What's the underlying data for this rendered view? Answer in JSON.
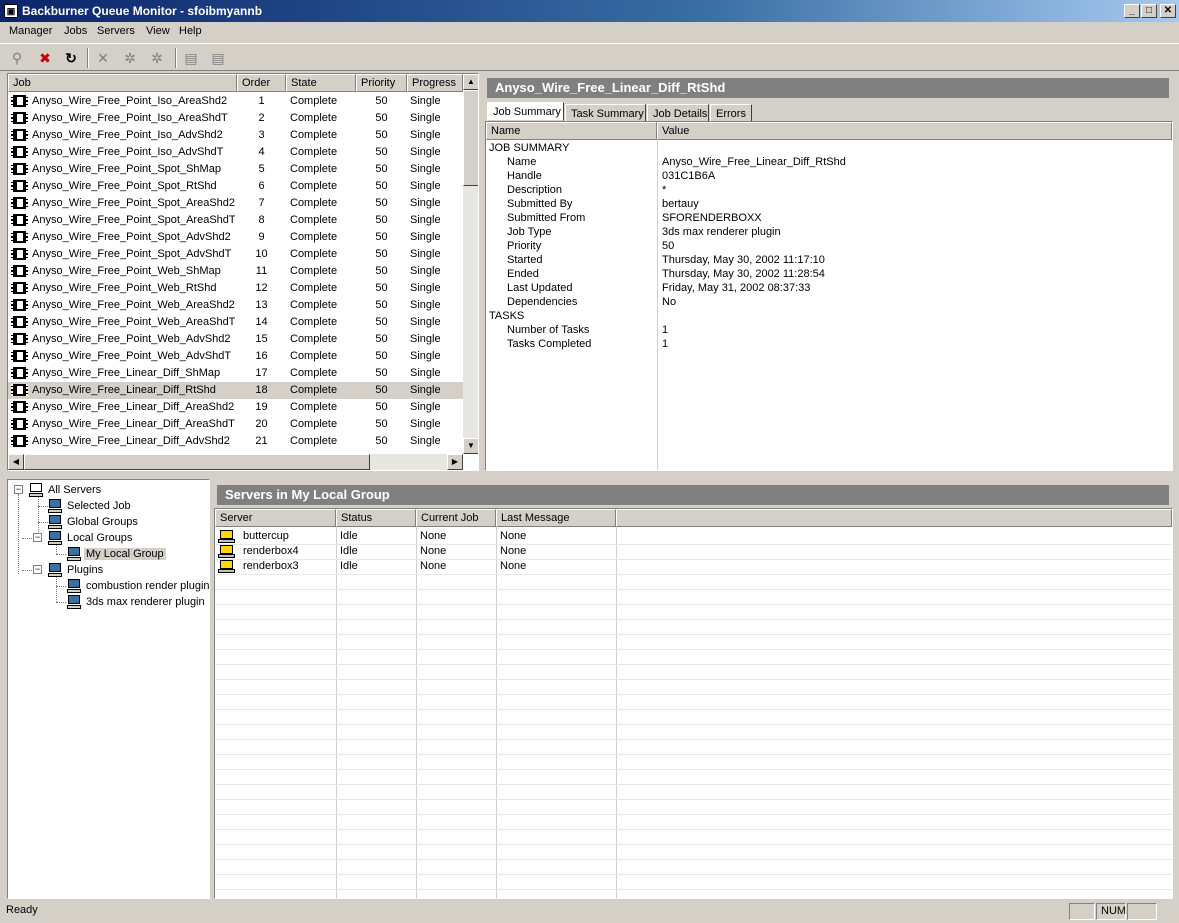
{
  "window": {
    "title": "Backburner Queue Monitor - sfoibmyannb",
    "min": "_",
    "max": "□",
    "close": "✕"
  },
  "menu": [
    "Manager",
    "Jobs",
    "Servers",
    "View",
    "Help"
  ],
  "jobs": {
    "columns": [
      "Job",
      "Order",
      "State",
      "Priority",
      "Progress"
    ],
    "rows": [
      [
        "Anyso_Wire_Free_Point_Iso_AreaShd2",
        "1",
        "Complete",
        "50",
        "Single"
      ],
      [
        "Anyso_Wire_Free_Point_Iso_AreaShdT",
        "2",
        "Complete",
        "50",
        "Single"
      ],
      [
        "Anyso_Wire_Free_Point_Iso_AdvShd2",
        "3",
        "Complete",
        "50",
        "Single"
      ],
      [
        "Anyso_Wire_Free_Point_Iso_AdvShdT",
        "4",
        "Complete",
        "50",
        "Single"
      ],
      [
        "Anyso_Wire_Free_Point_Spot_ShMap",
        "5",
        "Complete",
        "50",
        "Single"
      ],
      [
        "Anyso_Wire_Free_Point_Spot_RtShd",
        "6",
        "Complete",
        "50",
        "Single"
      ],
      [
        "Anyso_Wire_Free_Point_Spot_AreaShd2",
        "7",
        "Complete",
        "50",
        "Single"
      ],
      [
        "Anyso_Wire_Free_Point_Spot_AreaShdT",
        "8",
        "Complete",
        "50",
        "Single"
      ],
      [
        "Anyso_Wire_Free_Point_Spot_AdvShd2",
        "9",
        "Complete",
        "50",
        "Single"
      ],
      [
        "Anyso_Wire_Free_Point_Spot_AdvShdT",
        "10",
        "Complete",
        "50",
        "Single"
      ],
      [
        "Anyso_Wire_Free_Point_Web_ShMap",
        "11",
        "Complete",
        "50",
        "Single"
      ],
      [
        "Anyso_Wire_Free_Point_Web_RtShd",
        "12",
        "Complete",
        "50",
        "Single"
      ],
      [
        "Anyso_Wire_Free_Point_Web_AreaShd2",
        "13",
        "Complete",
        "50",
        "Single"
      ],
      [
        "Anyso_Wire_Free_Point_Web_AreaShdT",
        "14",
        "Complete",
        "50",
        "Single"
      ],
      [
        "Anyso_Wire_Free_Point_Web_AdvShd2",
        "15",
        "Complete",
        "50",
        "Single"
      ],
      [
        "Anyso_Wire_Free_Point_Web_AdvShdT",
        "16",
        "Complete",
        "50",
        "Single"
      ],
      [
        "Anyso_Wire_Free_Linear_Diff_ShMap",
        "17",
        "Complete",
        "50",
        "Single"
      ],
      [
        "Anyso_Wire_Free_Linear_Diff_RtShd",
        "18",
        "Complete",
        "50",
        "Single"
      ],
      [
        "Anyso_Wire_Free_Linear_Diff_AreaShd2",
        "19",
        "Complete",
        "50",
        "Single"
      ],
      [
        "Anyso_Wire_Free_Linear_Diff_AreaShdT",
        "20",
        "Complete",
        "50",
        "Single"
      ],
      [
        "Anyso_Wire_Free_Linear_Diff_AdvShd2",
        "21",
        "Complete",
        "50",
        "Single"
      ]
    ],
    "selected_index": 17
  },
  "detail": {
    "title": "Anyso_Wire_Free_Linear_Diff_RtShd",
    "tabs": [
      "Job Summary",
      "Task Summary",
      "Job Details",
      "Errors"
    ],
    "columns": [
      "Name",
      "Value"
    ],
    "rows": [
      [
        "JOB SUMMARY",
        ""
      ],
      [
        "Name",
        "Anyso_Wire_Free_Linear_Diff_RtShd"
      ],
      [
        "Handle",
        "031C1B6A"
      ],
      [
        "Description",
        "*"
      ],
      [
        "Submitted By",
        "bertauy"
      ],
      [
        "Submitted From",
        "SFORENDERBOXX"
      ],
      [
        "Job Type",
        "3ds max renderer plugin"
      ],
      [
        "Priority",
        "50"
      ],
      [
        "Started",
        "Thursday, May 30, 2002 11:17:10"
      ],
      [
        "Ended",
        "Thursday, May 30, 2002 11:28:54"
      ],
      [
        "Last Updated",
        "Friday, May 31, 2002 08:37:33"
      ],
      [
        "Dependencies",
        "No"
      ],
      [
        "TASKS",
        ""
      ],
      [
        "Number of Tasks",
        "1"
      ],
      [
        "Tasks Completed",
        "1"
      ]
    ]
  },
  "tree": {
    "items": [
      "All Servers",
      "Selected Job",
      "Global Groups",
      "Local Groups",
      "My Local Group",
      "Plugins",
      "combustion render plugin",
      "3ds max renderer plugin"
    ]
  },
  "servers": {
    "title": "Servers in My Local Group",
    "columns": [
      "Server",
      "Status",
      "Current Job",
      "Last Message"
    ],
    "rows": [
      [
        "buttercup",
        "Idle",
        "None",
        "None"
      ],
      [
        "renderbox4",
        "Idle",
        "None",
        "None"
      ],
      [
        "renderbox3",
        "Idle",
        "None",
        "None"
      ]
    ]
  },
  "status": {
    "text": "Ready",
    "num": "NUM"
  }
}
